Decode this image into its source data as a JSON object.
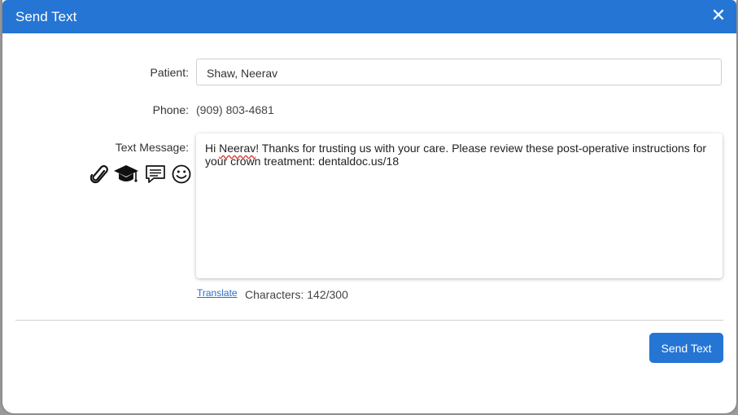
{
  "dialog": {
    "title": "Send Text",
    "close_icon": "close-icon",
    "accent_color": "#2575d4"
  },
  "form": {
    "patient_label": "Patient:",
    "patient_value": "Shaw, Neerav",
    "phone_label": "Phone:",
    "phone_value": "(909) 803-4681",
    "message_label": "Text Message:",
    "message_parts": {
      "greeting": "Hi ",
      "name": "Neerav",
      "body": "!   Thanks for trusting us with your care.  Please review these post-operative instructions for your crown treatment: dentaldoc.us/18"
    },
    "tools": [
      "paperclip-icon",
      "graduation-cap-icon",
      "speech-bubble-icon",
      "smiley-icon"
    ]
  },
  "footer": {
    "translate_label": "Translate",
    "characters_text": "Characters: 142/300",
    "send_button_label": "Send Text"
  }
}
